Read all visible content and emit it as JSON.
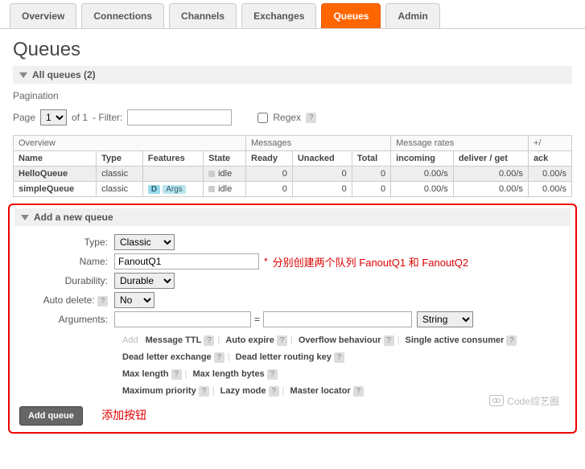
{
  "tabs": {
    "overview": "Overview",
    "connections": "Connections",
    "channels": "Channels",
    "exchanges": "Exchanges",
    "queues": "Queues",
    "admin": "Admin"
  },
  "heading": "Queues",
  "all_queues_label": "All queues (2)",
  "pagination": {
    "title": "Pagination",
    "page_label": "Page",
    "page_value": "1",
    "of_label": "of 1",
    "filter_label": "- Filter:",
    "regex_label": "Regex"
  },
  "table": {
    "groups": {
      "overview": "Overview",
      "messages": "Messages",
      "rates": "Message rates",
      "plus": "+/"
    },
    "cols": {
      "name": "Name",
      "type": "Type",
      "features": "Features",
      "state": "State",
      "ready": "Ready",
      "unacked": "Unacked",
      "total": "Total",
      "incoming": "incoming",
      "deliver": "deliver / get",
      "ack": "ack"
    },
    "rows": [
      {
        "name": "HelloQueue",
        "type": "classic",
        "features_d": false,
        "features_args": false,
        "state": "idle",
        "ready": "0",
        "unacked": "0",
        "total": "0",
        "incoming": "0.00/s",
        "deliver": "0.00/s",
        "ack": "0.00/s"
      },
      {
        "name": "simpleQueue",
        "type": "classic",
        "features_d": true,
        "features_args": true,
        "state": "idle",
        "ready": "0",
        "unacked": "0",
        "total": "0",
        "incoming": "0.00/s",
        "deliver": "0.00/s",
        "ack": "0.00/s"
      }
    ],
    "badge_d": "D",
    "badge_args": "Args"
  },
  "add_section": {
    "title": "Add a new queue",
    "type_label": "Type:",
    "type_value": "Classic",
    "name_label": "Name:",
    "name_value": "FanoutQ1",
    "name_note": "分别创建两个队列 FanoutQ1 和 FanoutQ2",
    "durability_label": "Durability:",
    "durability_value": "Durable",
    "autodelete_label": "Auto delete:",
    "autodelete_value": "No",
    "arguments_label": "Arguments:",
    "args_type_value": "String",
    "helpers": {
      "add": "Add",
      "line1": [
        "Message TTL",
        "Auto expire",
        "Overflow behaviour",
        "Single active consumer"
      ],
      "line2": [
        "Dead letter exchange",
        "Dead letter routing key"
      ],
      "line3": [
        "Max length",
        "Max length bytes"
      ],
      "line4": [
        "Maximum priority",
        "Lazy mode",
        "Master locator"
      ]
    },
    "button": "Add queue",
    "button_note": "添加按钮"
  },
  "watermark": "Code综艺圈"
}
